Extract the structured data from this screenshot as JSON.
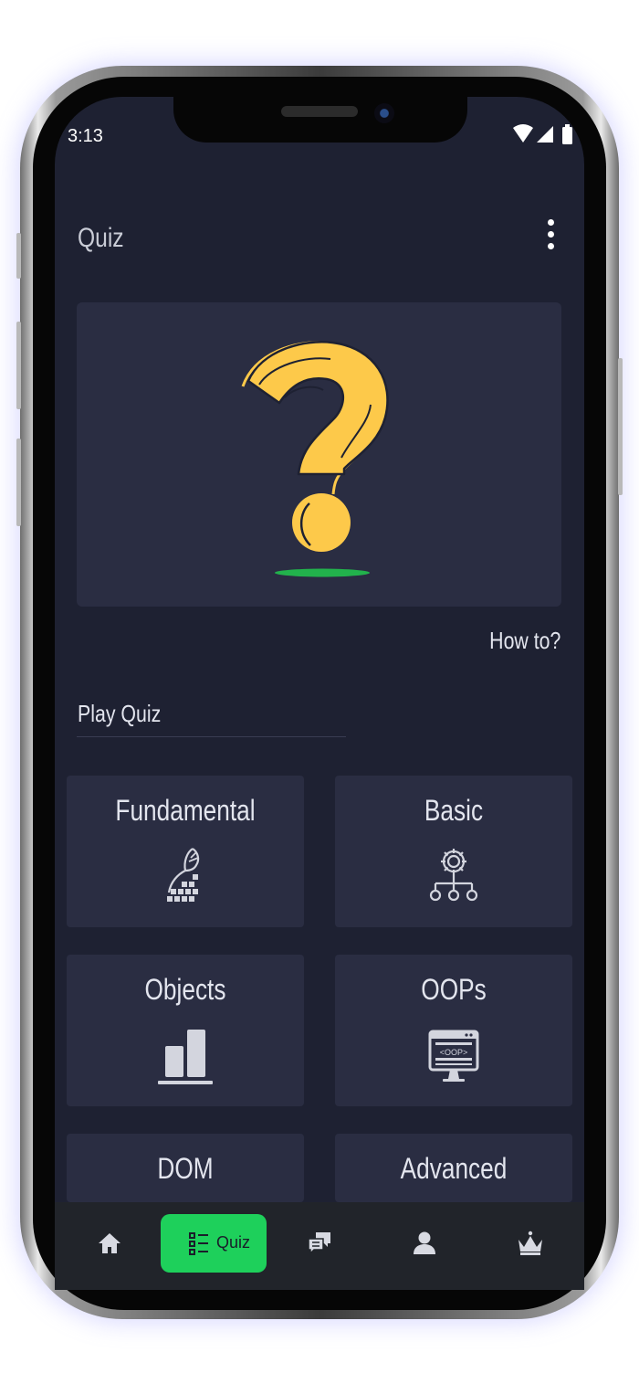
{
  "status_bar": {
    "time": "3:13"
  },
  "app_bar": {
    "title": "Quiz",
    "menu_icon": "more-vert-icon"
  },
  "hero": {
    "icon": "question-mark-illustration"
  },
  "how_to_label": "How to?",
  "section_title": "Play Quiz",
  "categories": [
    {
      "label": "Fundamental",
      "icon": "hand-blocks-icon"
    },
    {
      "label": "Basic",
      "icon": "gear-network-icon"
    },
    {
      "label": "Objects",
      "icon": "bar-chart-icon"
    },
    {
      "label": "OOPs",
      "icon": "oop-monitor-icon"
    },
    {
      "label": "DOM",
      "icon": ""
    },
    {
      "label": "Advanced",
      "icon": ""
    }
  ],
  "bottom_nav": {
    "active_label": "Quiz",
    "items": [
      "home-icon",
      "quiz-list-icon",
      "chat-icon",
      "person-icon",
      "crown-icon"
    ]
  },
  "colors": {
    "background": "#1e2132",
    "card": "#2a2d42",
    "accent": "#1ed05b",
    "question_mark": "#fdc94a",
    "nav_bar": "#21242a"
  }
}
